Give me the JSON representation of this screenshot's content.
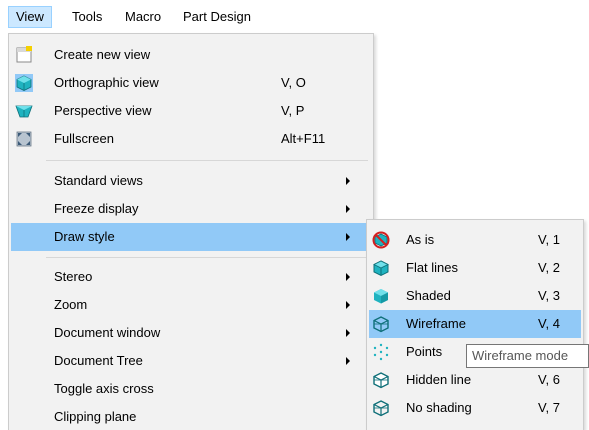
{
  "menubar": {
    "items": [
      {
        "label": "View"
      },
      {
        "label": "Tools"
      },
      {
        "label": "Macro"
      },
      {
        "label": "Part Design"
      }
    ]
  },
  "view_menu": {
    "items": [
      {
        "label": "Create new view",
        "shortcut": "",
        "icon": "new-view-icon"
      },
      {
        "label": "Orthographic view",
        "shortcut": "V, O",
        "icon": "orthographic-cube-icon"
      },
      {
        "label": "Perspective view",
        "shortcut": "V, P",
        "icon": "perspective-cube-icon"
      },
      {
        "label": "Fullscreen",
        "shortcut": "Alt+F11",
        "icon": "fullscreen-icon"
      },
      {
        "label": "Standard views",
        "shortcut": "",
        "submenu": true
      },
      {
        "label": "Freeze display",
        "shortcut": "",
        "submenu": true
      },
      {
        "label": "Draw style",
        "shortcut": "",
        "submenu": true
      },
      {
        "label": "Stereo",
        "shortcut": "",
        "submenu": true
      },
      {
        "label": "Zoom",
        "shortcut": "",
        "submenu": true
      },
      {
        "label": "Document window",
        "shortcut": "",
        "submenu": true
      },
      {
        "label": "Document Tree",
        "shortcut": "",
        "submenu": true
      },
      {
        "label": "Toggle axis cross",
        "shortcut": ""
      },
      {
        "label": "Clipping plane",
        "shortcut": ""
      }
    ]
  },
  "draw_style_menu": {
    "items": [
      {
        "label": "As is",
        "shortcut": "V, 1",
        "icon": "as-is-icon"
      },
      {
        "label": "Flat lines",
        "shortcut": "V, 2",
        "icon": "flat-lines-icon"
      },
      {
        "label": "Shaded",
        "shortcut": "V, 3",
        "icon": "shaded-icon"
      },
      {
        "label": "Wireframe",
        "shortcut": "V, 4",
        "icon": "wireframe-icon"
      },
      {
        "label": "Points",
        "shortcut": "",
        "icon": "points-icon"
      },
      {
        "label": "Hidden line",
        "shortcut": "V, 6",
        "icon": "hidden-line-icon"
      },
      {
        "label": "No shading",
        "shortcut": "V, 7",
        "icon": "no-shading-icon"
      }
    ]
  },
  "tooltip": {
    "text": "Wireframe mode"
  },
  "colors": {
    "highlight": "#91c9f7",
    "menubar_active": "#cce8ff",
    "menu_bg": "#f2f2f2",
    "icon_teal": "#1fb3c0",
    "icon_dark_teal": "#0e6f78"
  }
}
